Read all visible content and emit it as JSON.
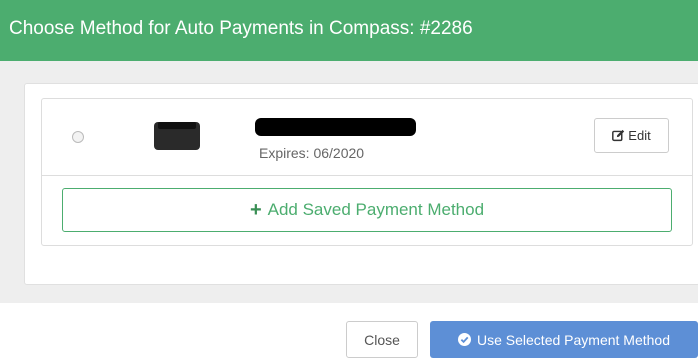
{
  "modal": {
    "title": "Choose Method for Auto Payments in Compass: #2286"
  },
  "payment_methods": [
    {
      "expires": "Expires: 06/2020",
      "edit_label": "Edit",
      "selected": false
    }
  ],
  "add_button": {
    "label": "Add Saved Payment Method"
  },
  "footer": {
    "close_label": "Close",
    "use_label": "Use Selected Payment Method"
  },
  "colors": {
    "header_bg": "#4cad6f",
    "primary_button": "#5d8fd6",
    "accent_green": "#4cad6f"
  },
  "icons": [
    "radio-icon",
    "edit-icon",
    "plus-icon",
    "check-circle-icon"
  ]
}
